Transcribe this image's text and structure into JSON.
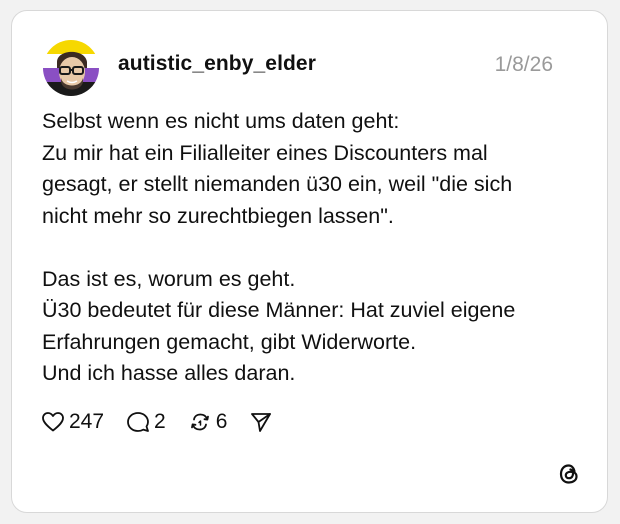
{
  "post": {
    "username": "autistic_enby_elder",
    "date": "1/8/26",
    "lines": [
      "Selbst wenn es nicht ums daten geht:",
      "Zu mir hat ein Filialleiter eines Discounters mal",
      "gesagt, er stellt niemanden ü30 ein, weil \"die sich",
      "nicht mehr so zurechtbiegen lassen\".",
      "",
      "Das ist es, worum es geht.",
      "Ü30 bedeutet für diese Männer: Hat zuviel eigene",
      "Erfahrungen gemacht, gibt Widerworte.",
      "Und ich hasse alles daran."
    ]
  },
  "actions": {
    "likes": "247",
    "replies": "2",
    "reposts": "6"
  },
  "icons": {
    "like": "heart-icon",
    "reply": "speech-bubble-icon",
    "repost": "repost-icon",
    "share": "paper-plane-icon",
    "brand": "threads-logo-icon"
  },
  "colors": {
    "card_background": "#ffffff",
    "page_background": "#f2f2f2",
    "text": "#101010",
    "date": "#9a9a9a",
    "border": "#d8d8d8"
  }
}
